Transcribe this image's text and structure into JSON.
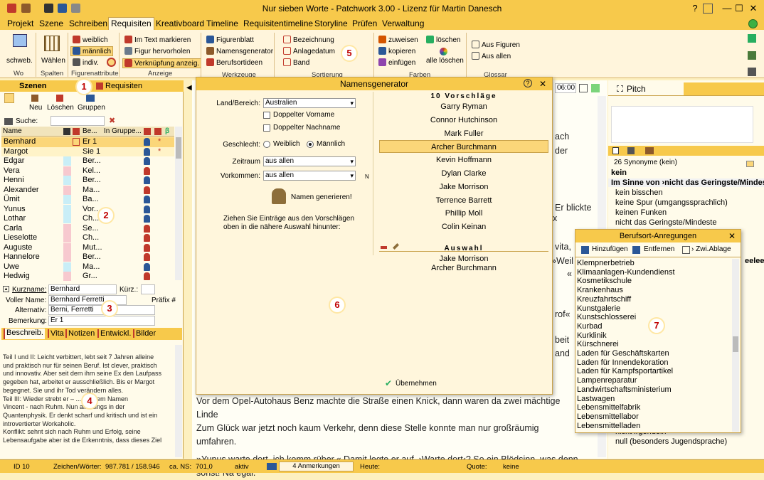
{
  "app": {
    "title": "Nur sieben Worte   -   Patchwork 3.00   -   Lizenz für Martin Danesch",
    "help": "?",
    "minimize": "—",
    "maximize": "☐",
    "close": "✕"
  },
  "menu": [
    "Projekt",
    "Szene",
    "Schreiben",
    "Requisiten",
    "Kreativboard",
    "Timeline",
    "Requisitentimeline",
    "Storyline",
    "Prüfen",
    "Verwaltung"
  ],
  "ribbon": {
    "wo": "schweb.",
    "wo_group": "Wo",
    "spalten": "Wählen",
    "spalten_group": "Spalten",
    "fig": [
      "weiblich",
      "männlich",
      "indiv."
    ],
    "fig_group": "Figurenattribute",
    "anz": [
      "Im Text markieren",
      "Figur hervorholen",
      "Verknüpfung anzeig."
    ],
    "anz_group": "Anzeige",
    "wz": [
      "Figurenblatt",
      "Namensgenerator",
      "Berufsortideen"
    ],
    "wz_group": "Werkzeuge",
    "sort": [
      "Bezeichnung",
      "Anlagedatum",
      "Band"
    ],
    "sort_group": "Sortierung",
    "farb": [
      "zuweisen",
      "kopieren",
      "einfügen",
      "löschen",
      "alle löschen"
    ],
    "farb_group": "Farben",
    "glossar": [
      "Aus Figuren",
      "Aus allen"
    ],
    "glossar_group": "Glossar"
  },
  "left": {
    "tab_szenen": "Szenen",
    "tab_requisiten": "Requisiten",
    "tb": [
      "Neu",
      "Löschen",
      "Gruppen"
    ],
    "search_label": "Suche:",
    "cols": [
      "Name",
      "Be...",
      "In Gruppe..."
    ],
    "rows": [
      {
        "name": "Bernhard",
        "be": "Er 1",
        "color": "#fbd679",
        "dot": "*"
      },
      {
        "name": "Margot",
        "be": "Sie 1",
        "color": "#fff3c8",
        "dot": "*"
      },
      {
        "name": "Edgar",
        "be": "Ber...",
        "color": "#c9eef7",
        "dot": ""
      },
      {
        "name": "Vera",
        "be": "Kel...",
        "color": "#f7c9cf",
        "dot": ""
      },
      {
        "name": "Henni",
        "be": "Ber...",
        "color": "#c9eef7",
        "dot": ""
      },
      {
        "name": "Alexander",
        "be": "Ma...",
        "color": "#f7c9cf",
        "dot": ""
      },
      {
        "name": "Ümit",
        "be": "Ba...",
        "color": "#c9eef7",
        "dot": ""
      },
      {
        "name": "Yunus",
        "be": "Vor...",
        "color": "#c9eef7",
        "dot": ""
      },
      {
        "name": "Lothar",
        "be": "Ch...",
        "color": "#c9eef7",
        "dot": ""
      },
      {
        "name": "Carla",
        "be": "Se...",
        "color": "#f7c9cf",
        "dot": ""
      },
      {
        "name": "Lieselotte",
        "be": "Ch...",
        "color": "#f7c9cf",
        "dot": ""
      },
      {
        "name": "Auguste",
        "be": "Mut...",
        "color": "#f7c9cf",
        "dot": ""
      },
      {
        "name": "Hannelore",
        "be": "Ber...",
        "color": "#f7c9cf",
        "dot": ""
      },
      {
        "name": "Uwe",
        "be": "Ma...",
        "color": "#c9eef7",
        "dot": ""
      },
      {
        "name": "Hedwig",
        "be": "Gr...",
        "color": "#f7c9cf",
        "dot": ""
      }
    ],
    "kurzname_lbl": "Kurzname:",
    "kurzname": "Bernhard",
    "kurz_lbl": "Kürz.:",
    "voll_lbl": "Voller Name:",
    "voll": "Bernhard Ferretti",
    "prefix": "Präfix #",
    "alt_lbl": "Alternativ:",
    "alt": "Berni, Ferretti",
    "bem_lbl": "Bemerkung:",
    "bem": "Er 1",
    "tabs": [
      "Beschreib.",
      "Vita",
      "Notizen",
      "Entwickl.",
      "Bilder"
    ],
    "desc": [
      "Teil I und II: Leicht verbittert, lebt seit 7 Jahren alleine",
      "und praktisch nur für seinen Beruf. Ist clever, praktisch",
      "und innovativ. Aber seit dem ihm seine Ex den Laufpass",
      "gegeben hat, arbeitet er ausschließlich. Bis er Margot",
      "begegnet. Sie und ihr Tod verändern alles.",
      "Teil III: Wieder strebt er – ... mit dem Namen",
      "Vincent - nach Ruhm. Nun allerdings in der",
      "Quantenphysik. Er denkt scharf und kritisch und ist ein",
      "introvertierter Workaholic.",
      "Konflikt: sehnt sich nach Ruhm und Erfolg, seine",
      "Lebensaufgabe aber ist die Erkenntnis, dass dieses Ziel"
    ]
  },
  "editor": {
    "time": "06:00",
    "lines": [
      "Vor dem Opel-Autohaus Benz machte die Straße einen Knick, dann waren da zwei mächtige Linde",
      "Zum Glück war jetzt noch kaum Verkehr, denn diese Stelle konnte man nur großräumig umfahren.",
      "   »Yunus warte dort, ich komm rüber.« Damit legte er auf. ›Warte dort‹? So ein Blödsinn, was denn",
      "sonst! Na egal."
    ],
    "frag": [
      "ach",
      "der",
      "Er blickte",
      "x",
      "rof«",
      "beit",
      "and",
      "»Weil",
      "vita,",
      "«"
    ]
  },
  "right": {
    "tab": "Pitch",
    "synonyms_count": "26 Synonyme (kein)",
    "word": "kein",
    "syns": [
      "Im Sinne von ›nicht das Geringste/Mindeste‹",
      "kein bisschen",
      "keine Spur (umgangssprachlich)",
      "keinen Funken",
      "nicht das Geringste/Mindeste",
      "nicht irgendein",
      "null (besonders Jugendsprache)"
    ],
    "frag": "eelee"
  },
  "dialog": {
    "title": "Namensgenerator",
    "help": "?",
    "close": "✕",
    "land_lbl": "Land/Bereich:",
    "land": "Australien",
    "dv": "Doppelter Vorname",
    "dn": "Doppelter Nachname",
    "geschlecht_lbl": "Geschlecht:",
    "weiblich": "Weiblich",
    "maennlich": "Männlich",
    "zeitraum_lbl": "Zeitraum",
    "zeitraum": "aus allen",
    "vorkommen_lbl": "Vorkommen:",
    "vorkommen": "aus allen",
    "n": "N",
    "gen": "Namen generieren!",
    "hint1": "Ziehen Sie Einträge aus den Vorschlägen",
    "hint2": "oben in die nähere Auswahl hinunter:",
    "vors_title": "10 Vorschläge",
    "vors": [
      "Garry Ryman",
      "Connor Hutchinson",
      "Mark Fuller",
      "Archer Burchmann",
      "Kevin Hoffmann",
      "Dylan Clarke",
      "Jake Morrison",
      "Terrence Barrett",
      "Phillip Moll",
      "Colin Keinan"
    ],
    "ausw_title": "Auswahl",
    "ausw": [
      "Jake Morrison",
      "Archer Burchmann"
    ],
    "ok": "Übernehmen"
  },
  "beruf": {
    "title": "Berufsort-Anregungen",
    "add": "Hinzufügen",
    "del": "Entfernen",
    "clip": "› Zwi.Ablage",
    "items": [
      "Klempnerbetrieb",
      "Klimaanlagen-Kundendienst",
      "Kosmetikschule",
      "Krankenhaus",
      "Kreuzfahrtschiff",
      "Kunstgalerie",
      "Kunstschlosserei",
      "Kurbad",
      "Kurklinik",
      "Kürschnerei",
      "Laden für Geschäftskarten",
      "Laden für Innendekoration",
      "Laden für Kampfsportartikel",
      "Lampenreparatur",
      "Landwirtschaftsministerium",
      "Lastwagen",
      "Lebensmittelfabrik",
      "Lebensmittellabor",
      "Lebensmittelladen"
    ]
  },
  "status": {
    "id": "ID 10",
    "zw_lbl": "Zeichen/Wörter:",
    "zw": "987.781 / 158.946",
    "ns_lbl": "ca. NS:",
    "ns": "701,0",
    "aktiv": "aktiv",
    "anm": "4 Anmerkungen",
    "heute": "Heute:",
    "quote": "Quote:",
    "keine": "keine"
  },
  "markers": [
    "1",
    "2",
    "3",
    "4",
    "5",
    "6",
    "7"
  ]
}
